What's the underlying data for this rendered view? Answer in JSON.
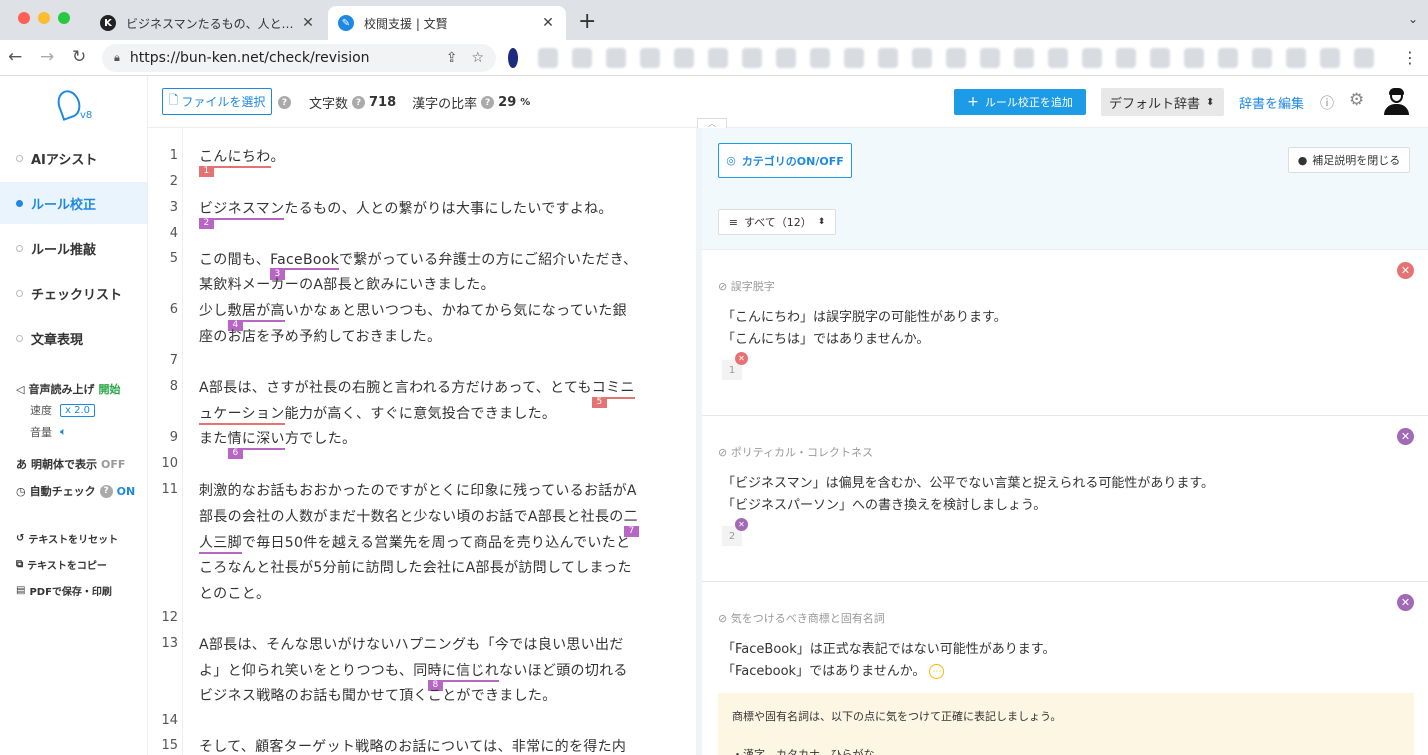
{
  "browser": {
    "tabs": [
      {
        "title": "ビジネスマンたるもの、人との繋がり",
        "favicon": "K"
      },
      {
        "title": "校閲支援 | 文賢",
        "favicon": "✎"
      }
    ],
    "url": "https://bun-ken.net/check/revision"
  },
  "sidebar": {
    "version": "v8",
    "items": [
      {
        "label": "AIアシスト"
      },
      {
        "label": "ルール校正"
      },
      {
        "label": "ルール推敲"
      },
      {
        "label": "チェックリスト"
      },
      {
        "label": "文章表現"
      }
    ],
    "tts_label": "音声読み上げ",
    "tts_start": "開始",
    "speed_label": "速度",
    "speed_value": "x 2.0",
    "volume_label": "音量",
    "mincho_label": "明朝体で表示",
    "mincho_state": "OFF",
    "autocheck_label": "自動チェック",
    "autocheck_state": "ON",
    "reset_label": "テキストをリセット",
    "copy_label": "テキストをコピー",
    "pdf_label": "PDFで保存・印刷"
  },
  "topbar": {
    "file_button": "ファイルを選択",
    "char_count_label": "文字数",
    "char_count": "718",
    "kanji_label": "漢字の比率",
    "kanji_ratio": "29",
    "kanji_unit": "%",
    "add_rule": "ルール校正を追加",
    "dict": "デフォルト辞書",
    "edit_dict": "辞書を編集"
  },
  "editor": {
    "lines": [
      {
        "num": "1",
        "segs": [
          {
            "t": "こんにちわ",
            "hl": "red",
            "badge": "1"
          },
          {
            "t": "。"
          }
        ]
      },
      {
        "num": "2",
        "segs": []
      },
      {
        "num": "3",
        "segs": [
          {
            "t": "ビジネスマン",
            "hl": "purple",
            "badge": "2"
          },
          {
            "t": "たるもの、人との繋がりは大事にしたいですよね。"
          }
        ]
      },
      {
        "num": "4",
        "segs": []
      },
      {
        "num": "5",
        "segs": [
          {
            "t": "この間も、"
          },
          {
            "t": "FaceBook",
            "hl": "purple",
            "badge": "3"
          },
          {
            "t": "で繋がっている弁護士の方にご紹介いただき、"
          }
        ]
      },
      {
        "num": "",
        "segs": [
          {
            "t": "某飲料メーカーのA部長と飲みにいきました。"
          }
        ]
      },
      {
        "num": "6",
        "segs": [
          {
            "t": "少し"
          },
          {
            "t": "敷居が高",
            "hl": "purple",
            "badge": "4"
          },
          {
            "t": "いかなぁと思いつつも、かねてから気になっていた銀"
          }
        ]
      },
      {
        "num": "",
        "segs": [
          {
            "t": "座のお店を予め予約しておきました。"
          }
        ]
      },
      {
        "num": "7",
        "segs": []
      },
      {
        "num": "8",
        "segs": [
          {
            "t": "A部長は、さすが社長の右腕と言われる方だけあって、とても"
          },
          {
            "t": "コミニ",
            "hl": "red",
            "badge": "5"
          }
        ]
      },
      {
        "num": "",
        "segs": [
          {
            "t": "ュケーション",
            "hl": "red"
          },
          {
            "t": "能力が高く、すぐに意気投合できました。"
          }
        ]
      },
      {
        "num": "9",
        "segs": [
          {
            "t": "また"
          },
          {
            "t": "情に深い",
            "hl": "purple",
            "badge": "6"
          },
          {
            "t": "方でした。"
          }
        ]
      },
      {
        "num": "10",
        "segs": []
      },
      {
        "num": "11",
        "segs": [
          {
            "t": "刺激的なお話もおおかったのですがとくに印象に残っているお話がA"
          }
        ]
      },
      {
        "num": "",
        "segs": [
          {
            "t": "部長の会社の人数がまだ十数名と少ない頃のお話でA部長と社長の"
          },
          {
            "t": "二",
            "hl": "purple",
            "badge": "7"
          }
        ]
      },
      {
        "num": "",
        "segs": [
          {
            "t": "人三脚",
            "hl": "purple"
          },
          {
            "t": "で毎日50件を越える営業先を周って商品を売り込んでいたと"
          }
        ]
      },
      {
        "num": "",
        "segs": [
          {
            "t": "ころなんと社長が5分前に訪問した会社にA部長が訪問してしまった"
          }
        ]
      },
      {
        "num": "",
        "segs": [
          {
            "t": "とのこと。"
          }
        ]
      },
      {
        "num": "12",
        "segs": []
      },
      {
        "num": "13",
        "segs": [
          {
            "t": "A部長は、そんな思いがけないハプニングも「今では良い思い出だ"
          }
        ]
      },
      {
        "num": "",
        "segs": [
          {
            "t": "よ」と仰られ笑いをとりつつも、同"
          },
          {
            "t": "時に信じれ",
            "hl": "purple",
            "badge": "8"
          },
          {
            "t": "ないほど頭の切れる"
          }
        ]
      },
      {
        "num": "",
        "segs": [
          {
            "t": "ビジネス戦略のお話も聞かせて頂くことができました。"
          }
        ]
      },
      {
        "num": "14",
        "segs": []
      },
      {
        "num": "15",
        "segs": [
          {
            "t": "そして、顧客ターゲット戦略のお話については、非常に的を得た内"
          }
        ]
      }
    ]
  },
  "panel": {
    "category_toggle": "カテゴリのON/OFF",
    "close_explain": "補足説明を閉じる",
    "filter": "すべて（12）",
    "cards": [
      {
        "category": "誤字脱字",
        "line1": "「こんにちわ」は誤字脱字の可能性があります。",
        "line2": "「こんにちは」ではありませんか。",
        "num": "1",
        "color": "#e57373"
      },
      {
        "category": "ポリティカル・コレクトネス",
        "line1": "「ビジネスマン」は偏見を含むか、公平でない言葉と捉えられる可能性があります。",
        "line2": "「ビジネスパーソン」への書き換えを検討しましょう。",
        "num": "2",
        "color": "#a06ab4"
      },
      {
        "category": "気をつけるべき商標と固有名詞",
        "line1": "「FaceBook」は正式な表記ではない可能性があります。",
        "line2": "「Facebook」ではありませんか。",
        "color": "#a06ab4"
      }
    ],
    "explain_line1": "商標や固有名詞は、以下の点に気をつけて正確に表記しましょう。",
    "explain_line2": "・漢字、カタカナ、ひらがな"
  }
}
